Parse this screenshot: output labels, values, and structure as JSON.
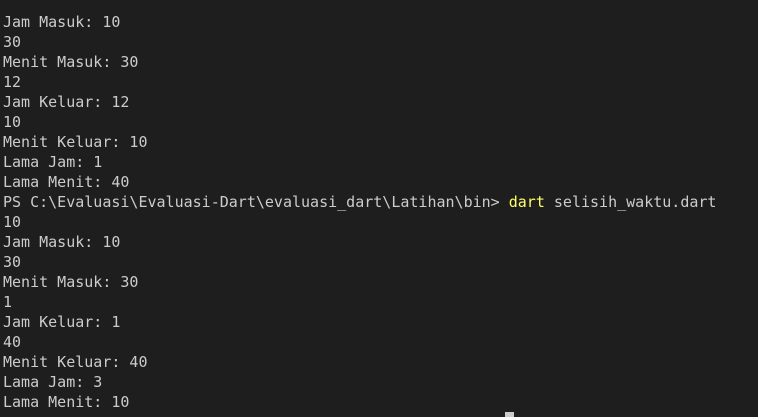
{
  "terminal": {
    "lines_before": [
      "Jam Masuk: 10",
      "30",
      "Menit Masuk: 30",
      "12",
      "10",
      "Menit Keluar: 10",
      "Lama Jam: 1",
      "Lama Menit: 40"
    ],
    "lines_before_b": [
      "Jam Keluar: 12"
    ],
    "prompt": {
      "path": "PS C:\\Evaluasi\\Evaluasi-Dart\\evaluasi_dart\\Latihan\\bin> ",
      "command": "dart",
      "args": " selisih_waktu.dart"
    },
    "lines_after": [
      "10",
      "Jam Masuk: 10",
      "30",
      "Menit Masuk: 30",
      "1",
      "Jam Keluar: 1",
      "40",
      "Menit Keluar: 40",
      "Lama Jam: 3",
      "Lama Menit: 10"
    ],
    "colors": {
      "background": "#1e1e1e",
      "text": "#cccccc",
      "command_highlight": "#ffff66"
    }
  }
}
